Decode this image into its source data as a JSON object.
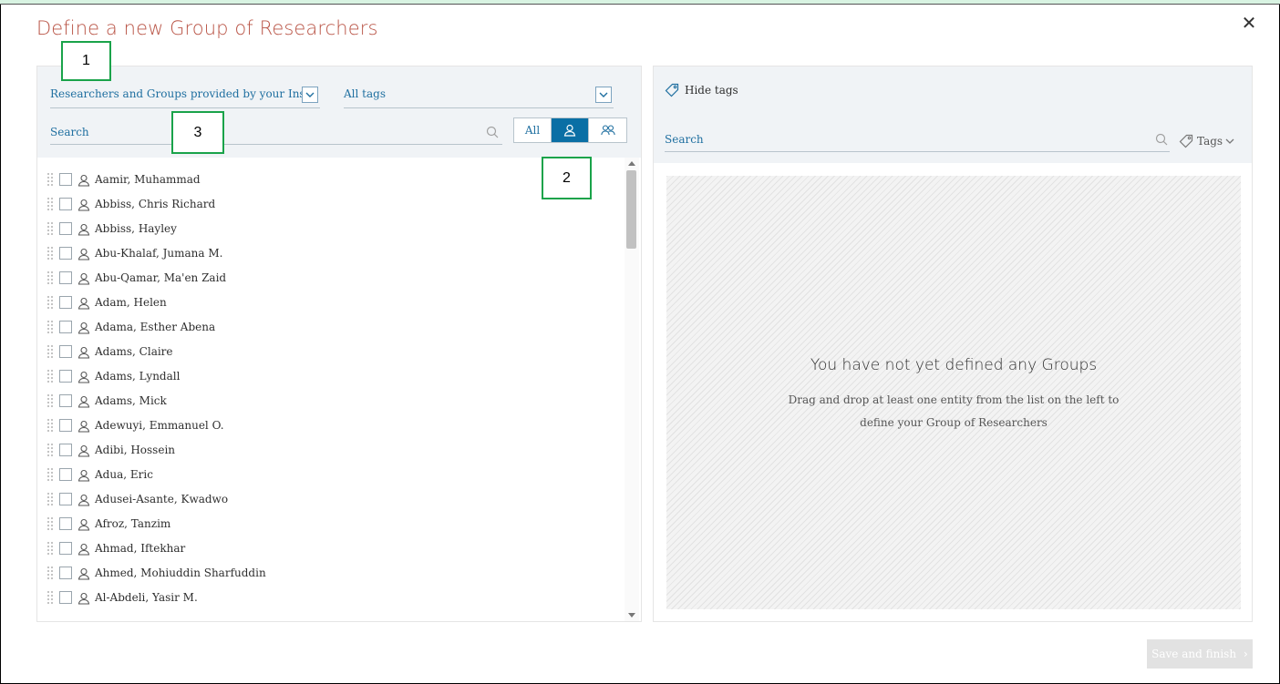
{
  "dialog": {
    "title": "Define a new Group of Researchers",
    "close_glyph": "✕"
  },
  "callouts": [
    "1",
    "2",
    "3"
  ],
  "left": {
    "source_select": "Researchers and Groups provided by your Ins...",
    "tag_select": "All tags",
    "search_placeholder": "Search",
    "filter": {
      "all": "All",
      "selected": "researchers"
    },
    "researchers": [
      "Aamir, Muhammad",
      "Abbiss, Chris Richard",
      "Abbiss, Hayley",
      "Abu-Khalaf, Jumana M.",
      "Abu-Qamar, Ma'en Zaid",
      "Adam, Helen",
      "Adama, Esther Abena",
      "Adams, Claire",
      "Adams, Lyndall",
      "Adams, Mick",
      "Adewuyi, Emmanuel O.",
      "Adibi, Hossein",
      "Adua, Eric",
      "Adusei-Asante, Kwadwo",
      "Afroz, Tanzim",
      "Ahmad, Iftekhar",
      "Ahmed, Mohiuddin Sharfuddin",
      "Al-Abdeli, Yasir M."
    ]
  },
  "right": {
    "hide_tags": "Hide tags",
    "search_placeholder": "Search",
    "tags_dropdown": "Tags",
    "empty_title": "You have not yet defined any Groups",
    "empty_text": "Drag and drop at least one entity from the list on the left to define your Group of Researchers"
  },
  "footer": {
    "save_label": "Save and finish"
  },
  "colors": {
    "title": "#b95446",
    "accent": "#0a6fa5",
    "link": "#1f6fa0",
    "callout_border": "#1aa34a",
    "top_strip": "#d8f3e2"
  },
  "icons": [
    "close-icon",
    "chevron-down-icon",
    "search-icon",
    "person-icon",
    "people-icon",
    "tag-icon",
    "drag-handle-icon",
    "chevron-right-icon"
  ]
}
